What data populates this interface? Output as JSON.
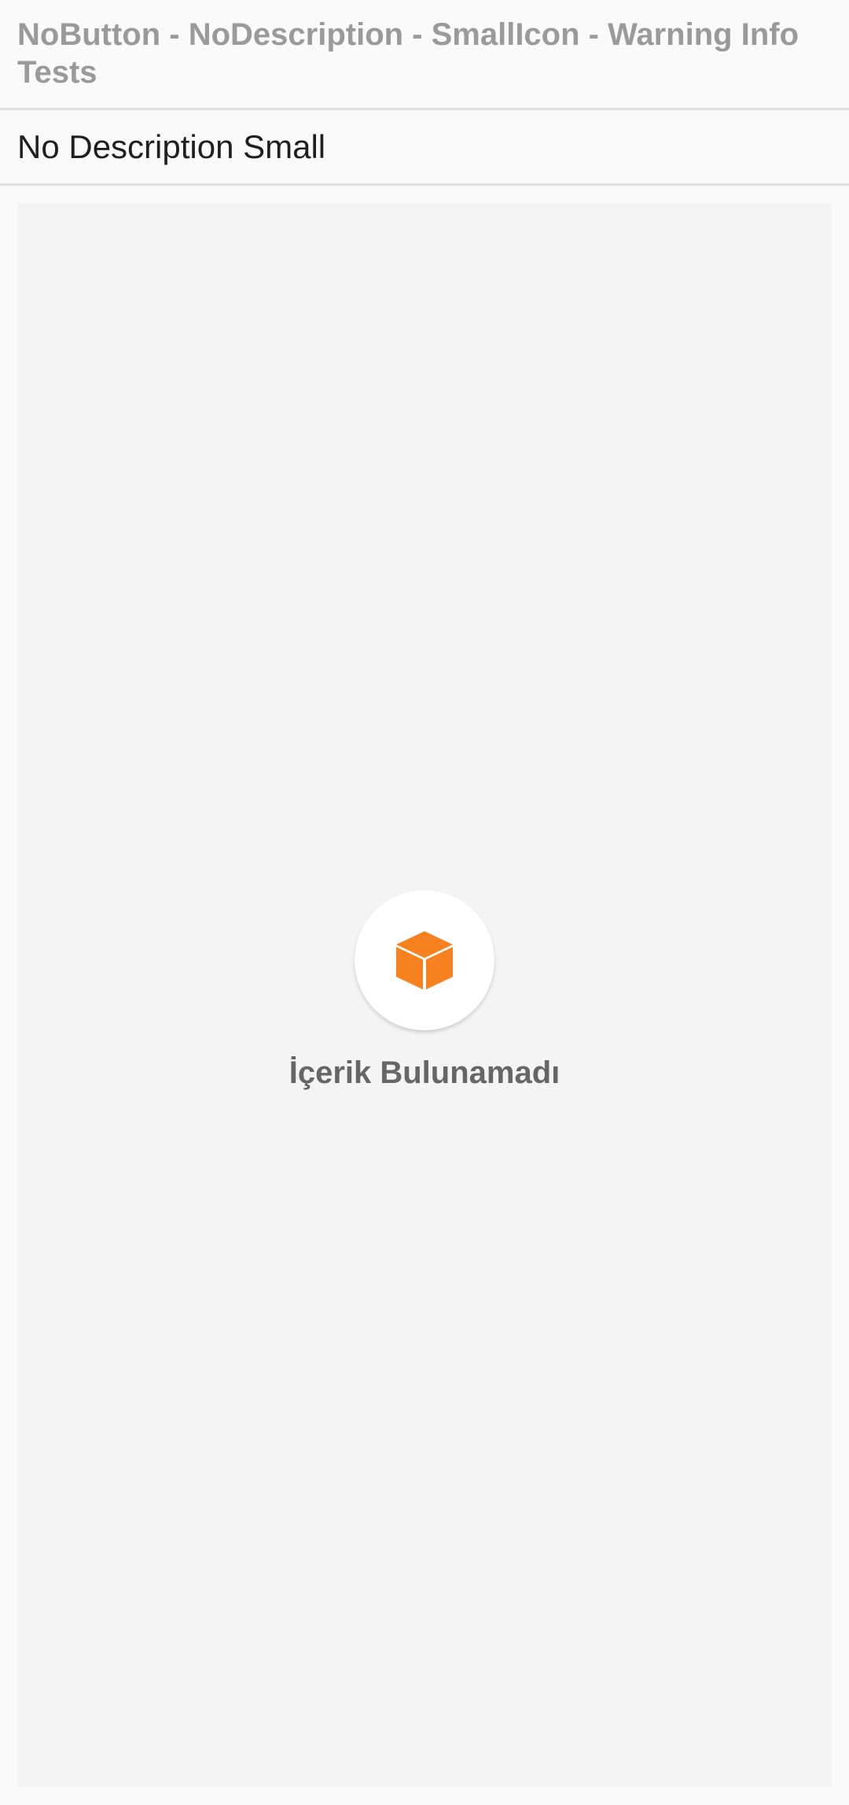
{
  "header": {
    "title": "NoButton - NoDescription - SmallIcon - Warning Info Tests"
  },
  "subheader": {
    "title": "No Description Small"
  },
  "empty_state": {
    "icon": "box-icon",
    "icon_color": "#f5821f",
    "message": "İçerik Bulunamadı"
  }
}
